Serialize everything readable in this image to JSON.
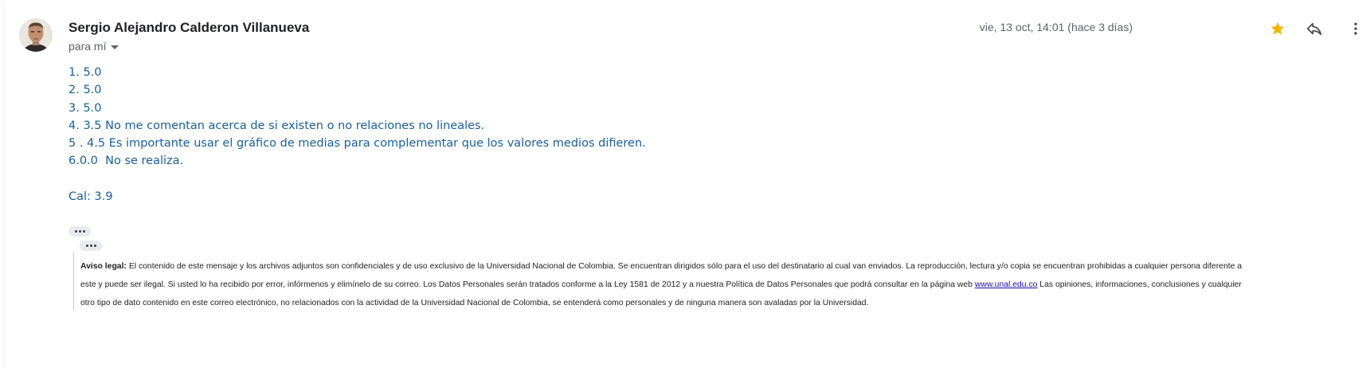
{
  "sender": {
    "name": "Sergio Alejandro Calderon Villanueva",
    "recipient_label": "para mí"
  },
  "header": {
    "date": "vie, 13 oct, 14:01 (hace 3 días)",
    "icons": [
      "star-icon",
      "reply-icon",
      "more-vert-icon"
    ],
    "star_color": "#f4b400"
  },
  "body": {
    "lines": [
      "1. 5.0",
      "2. 5.0",
      "3. 5.0",
      "4. 3.5 No me comentan acerca de si existen o no relaciones no lineales.",
      "5 . 4.5 Es importante usar el gráfico de medias para complementar que los valores medios difieren.",
      "6.0.0  No se realiza."
    ],
    "grade": "Cal: 3.9",
    "text_color": "#1a5fa0"
  },
  "legal": {
    "title": "Aviso legal:",
    "text_part1": " El contenido de este mensaje y los archivos adjuntos son confidenciales y de uso exclusivo de la Universidad Nacional de Colombia. Se encuentran dirigidos sólo para el uso del destinatario al cual van enviados. La reproducción, lectura y/o copia se encuentran prohibidas a cualquier persona diferente a este y puede ser ilegal. Si usted lo ha recibido por error, infórmenos y elimínelo de su correo. Los Datos Personales serán tratados conforme a la Ley 1581 de 2012 y a nuestra Política de Datos Personales que podrá consultar en la página web ",
    "link": "www.unal.edu.co",
    "text_part2": " Las opiniones, informaciones, conclusiones y cualquier otro tipo de dato contenido en este correo electrónico, no relacionados con la actividad de la Universidad Nacional de Colombia, se entenderá como personales y de ninguna manera son avaladas por la Universidad."
  }
}
